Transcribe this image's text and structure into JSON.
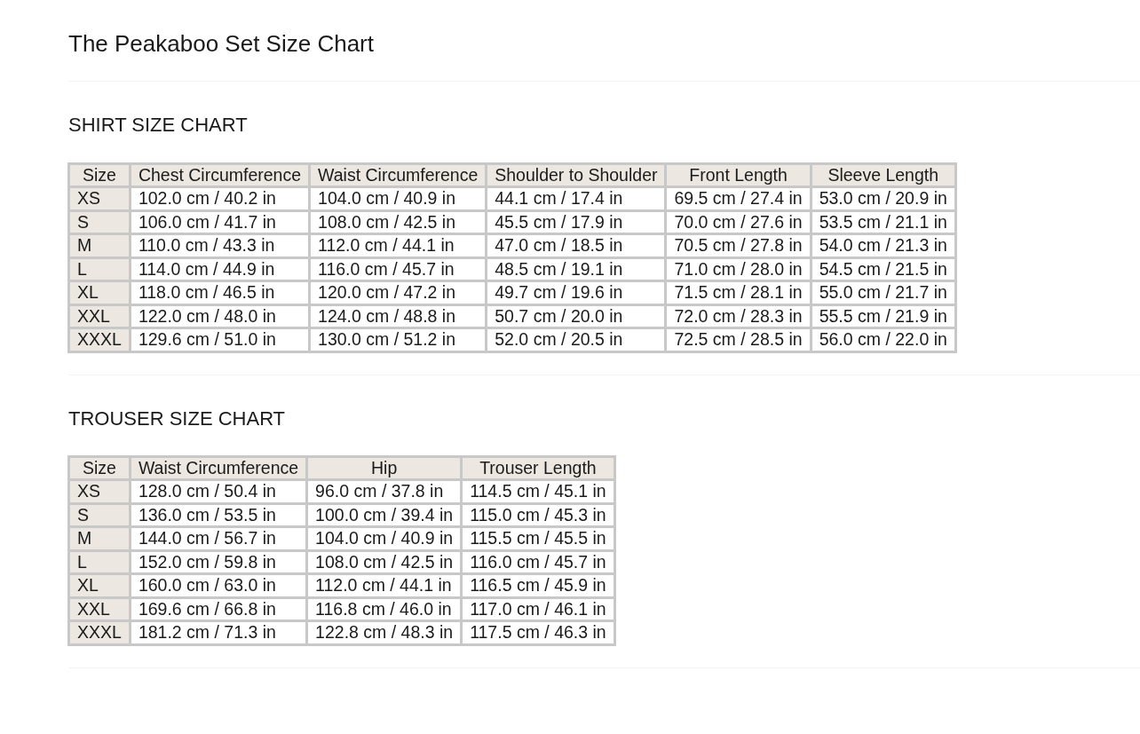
{
  "title": "The Peakaboo Set Size Chart",
  "sections": [
    {
      "heading": "SHIRT SIZE CHART",
      "table": {
        "columns": [
          "Size",
          "Chest Circumference",
          "Waist Circumference",
          "Shoulder to Shoulder",
          "Front Length",
          "Sleeve Length"
        ],
        "rows": [
          [
            "XS",
            "102.0 cm / 40.2 in",
            "104.0 cm / 40.9 in",
            "44.1 cm / 17.4 in",
            "69.5 cm / 27.4 in",
            "53.0 cm / 20.9 in"
          ],
          [
            "S",
            "106.0 cm / 41.7 in",
            "108.0 cm / 42.5 in",
            "45.5 cm / 17.9 in",
            "70.0 cm / 27.6 in",
            "53.5 cm / 21.1 in"
          ],
          [
            "M",
            "110.0 cm / 43.3 in",
            "112.0 cm / 44.1 in",
            "47.0 cm / 18.5 in",
            "70.5 cm / 27.8 in",
            "54.0 cm / 21.3 in"
          ],
          [
            "L",
            "114.0 cm / 44.9 in",
            "116.0 cm / 45.7 in",
            "48.5 cm / 19.1 in",
            "71.0 cm / 28.0 in",
            "54.5 cm / 21.5 in"
          ],
          [
            "XL",
            "118.0 cm / 46.5 in",
            "120.0 cm / 47.2 in",
            "49.7 cm / 19.6 in",
            "71.5 cm / 28.1 in",
            "55.0 cm / 21.7 in"
          ],
          [
            "XXL",
            "122.0 cm / 48.0 in",
            "124.0 cm / 48.8 in",
            "50.7 cm / 20.0 in",
            "72.0 cm / 28.3 in",
            "55.5 cm / 21.9 in"
          ],
          [
            "XXXL",
            "129.6 cm / 51.0 in",
            "130.0 cm / 51.2 in",
            "52.0 cm / 20.5 in",
            "72.5 cm / 28.5 in",
            "56.0 cm / 22.0 in"
          ]
        ]
      }
    },
    {
      "heading": "TROUSER SIZE CHART",
      "table": {
        "columns": [
          "Size",
          "Waist Circumference",
          "Hip",
          "Trouser Length"
        ],
        "rows": [
          [
            "XS",
            "128.0 cm / 50.4 in",
            "96.0 cm / 37.8 in",
            "114.5 cm / 45.1 in"
          ],
          [
            "S",
            "136.0 cm / 53.5 in",
            "100.0 cm / 39.4 in",
            "115.0 cm / 45.3 in"
          ],
          [
            "M",
            "144.0 cm / 56.7 in",
            "104.0 cm / 40.9 in",
            "115.5 cm / 45.5 in"
          ],
          [
            "L",
            "152.0 cm / 59.8 in",
            "108.0 cm / 42.5 in",
            "116.0 cm / 45.7 in"
          ],
          [
            "XL",
            "160.0 cm / 63.0 in",
            "112.0 cm / 44.1 in",
            "116.5 cm / 45.9 in"
          ],
          [
            "XXL",
            "169.6 cm / 66.8 in",
            "116.8 cm / 46.0 in",
            "117.0 cm / 46.1 in"
          ],
          [
            "XXXL",
            "181.2 cm / 71.3 in",
            "122.8 cm / 48.3 in",
            "117.5 cm / 46.3 in"
          ]
        ]
      }
    }
  ]
}
